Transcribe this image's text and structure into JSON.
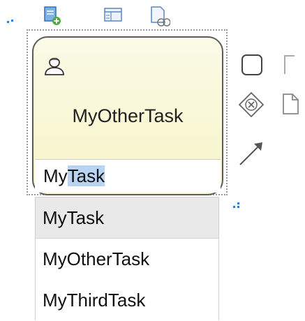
{
  "task": {
    "name": "MyOtherTask"
  },
  "editor": {
    "typed_prefix": "My",
    "selected_suggestion": "Task"
  },
  "dropdown": {
    "items": [
      {
        "label": "MyTask",
        "active": true
      },
      {
        "label": "MyOtherTask",
        "active": false
      },
      {
        "label": "MyThirdTask",
        "active": false
      }
    ]
  },
  "toolbar": {
    "icons": [
      "add-document-icon",
      "form-icon",
      "document-settings-icon"
    ]
  },
  "palette": {
    "icons": [
      "task-shape-icon",
      "annotation-icon",
      "gateway-icon",
      "document-icon",
      "connector-arrow-icon"
    ]
  },
  "colors": {
    "task_fill": "#f7f4c6",
    "selection_highlight": "#b9d4f3",
    "accent": "#2f7fd0"
  }
}
